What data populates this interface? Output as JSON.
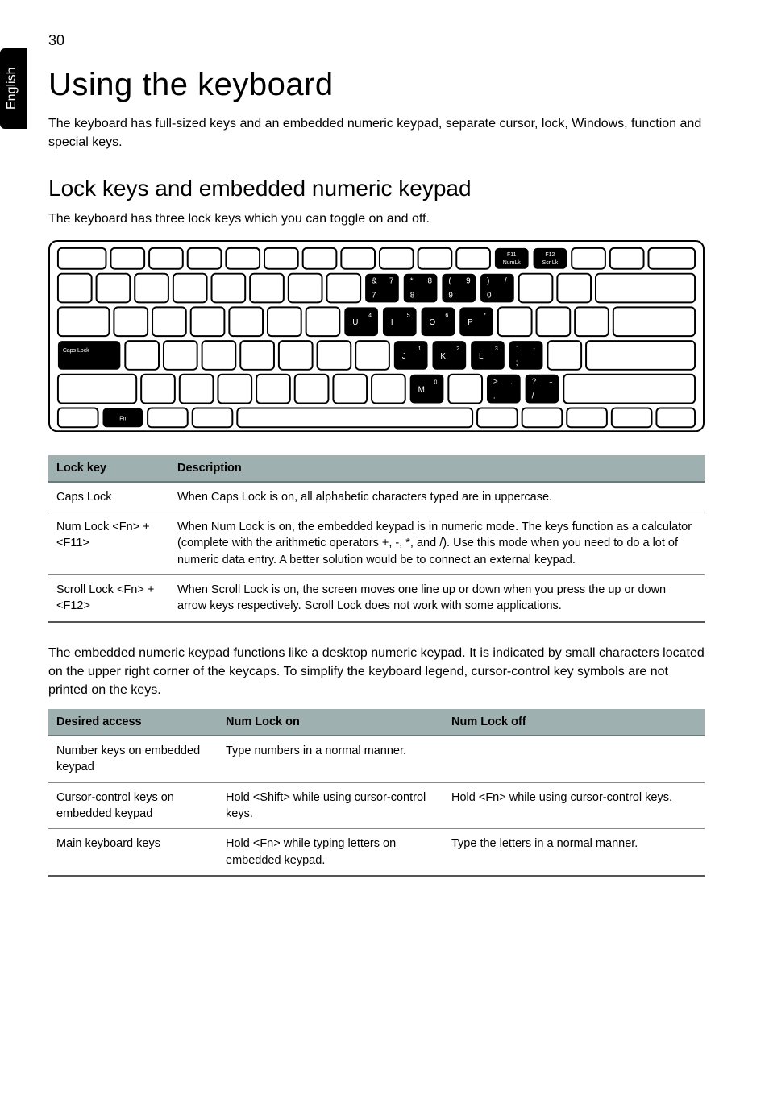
{
  "side_label": "English",
  "page_number": "30",
  "h1": "Using the keyboard",
  "intro": "The keyboard has full-sized keys and an embedded numeric keypad, separate cursor, lock, Windows, function and special keys.",
  "h2": "Lock keys and embedded numeric keypad",
  "sub_intro": "The keyboard has three lock keys which you can toggle on and off.",
  "keyboard": {
    "caps_lock": "Caps Lock",
    "fn": "Fn",
    "f11_top": "F11",
    "f11_sub": "NumLk",
    "f12_top": "F12",
    "f12_sub": "Scr Lk",
    "row1": [
      {
        "tl": "&",
        "tr": "7",
        "bl": "7"
      },
      {
        "tl": "*",
        "tr": "8",
        "bl": "8"
      },
      {
        "tl": "(",
        "tr": "9",
        "bl": "9"
      },
      {
        "tl": ")",
        "tr": "/",
        "bl": "0"
      }
    ],
    "row2": [
      {
        "main": "U",
        "sub": "4"
      },
      {
        "main": "I",
        "sub": "5"
      },
      {
        "main": "O",
        "sub": "6"
      },
      {
        "main": "P",
        "sub": "*"
      }
    ],
    "row3": [
      {
        "main": "J",
        "sub": "1"
      },
      {
        "main": "K",
        "sub": "2"
      },
      {
        "main": "L",
        "sub": "3"
      },
      {
        "tl": ":",
        "tr": "-",
        "bl": ";"
      }
    ],
    "row4": [
      {
        "main": "M",
        "sub": "0"
      },
      {
        "tl": "<",
        "bl": ","
      },
      {
        "tl": ">",
        "tr": ".",
        "bl": "."
      },
      {
        "tl": "?",
        "tr": "+",
        "bl": "/"
      }
    ]
  },
  "table1": {
    "headers": [
      "Lock key",
      "Description"
    ],
    "rows": [
      {
        "key": "Caps Lock",
        "desc": "When Caps Lock is on, all alphabetic characters typed are in uppercase."
      },
      {
        "key": "Num Lock <Fn> + <F11>",
        "desc": "When Num Lock is on, the embedded keypad is in numeric mode. The keys function as a calculator (complete with the arithmetic operators +, -, *, and /). Use this mode when you need to do a lot of numeric data entry. A better solution would be to connect an external keypad."
      },
      {
        "key": "Scroll Lock <Fn> + <F12>",
        "desc": "When Scroll Lock is on, the screen moves one line up or down when you press the up or down arrow keys respectively. Scroll Lock does not work with some applications."
      }
    ]
  },
  "mid_para": "The embedded numeric keypad functions like a desktop numeric keypad. It is indicated by small characters located on the upper right corner of the keycaps. To simplify the keyboard legend, cursor-control key symbols are not printed on the keys.",
  "table2": {
    "headers": [
      "Desired access",
      "Num Lock on",
      "Num Lock off"
    ],
    "rows": [
      {
        "c1": "Number keys on embedded keypad",
        "c2": "Type numbers in a normal manner.",
        "c3": ""
      },
      {
        "c1": "Cursor-control keys on embedded keypad",
        "c2": "Hold <Shift> while using cursor-control keys.",
        "c3": "Hold <Fn> while using cursor-control keys."
      },
      {
        "c1": "Main keyboard keys",
        "c2": "Hold <Fn> while typing letters on embedded keypad.",
        "c3": "Type the letters in a normal manner."
      }
    ]
  }
}
